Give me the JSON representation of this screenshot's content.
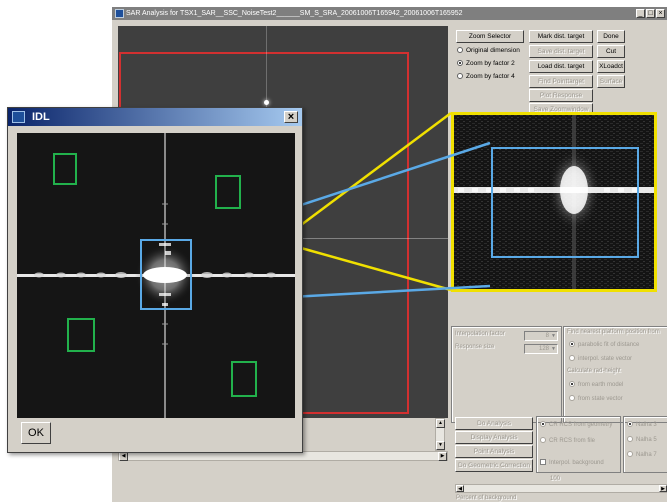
{
  "main_window": {
    "title": "SAR Analysis for TSX1_SAR__SSC_NoiseTest2______SM_S_SRA_20061006T165942_20061006T165952",
    "controls": {
      "minimize": "_",
      "maximize": "□",
      "close": "×"
    }
  },
  "zoom": {
    "selector_label": "Zoom Selector",
    "options": [
      {
        "label": "Original dimension",
        "selected": false
      },
      {
        "label": "Zoom by factor 2",
        "selected": true
      },
      {
        "label": "Zoom by factor 4",
        "selected": false
      }
    ]
  },
  "target_buttons": [
    {
      "label": "Mark dist. target",
      "enabled": true
    },
    {
      "label": "Save dist. target",
      "enabled": false
    },
    {
      "label": "Load dist. target",
      "enabled": true
    },
    {
      "label": "Find Pointtarget",
      "enabled": false
    },
    {
      "label": "Plot Response",
      "enabled": false
    },
    {
      "label": "Save Zoomwindow",
      "enabled": false
    }
  ],
  "action_buttons": [
    {
      "label": "Done",
      "enabled": true
    },
    {
      "label": "Cut",
      "enabled": true
    },
    {
      "label": "XLoadct",
      "enabled": true
    },
    {
      "label": "Surface",
      "enabled": false
    }
  ],
  "settings": {
    "interpolation_label": "Interpolation factor",
    "interpolation_value": "8",
    "response_label": "Response size",
    "response_value": "128"
  },
  "platform": {
    "heading": "Find nearest platform position from",
    "options": [
      "parabolic fit of distance",
      "interpol. state vector"
    ],
    "height_heading": "Calculate rad-height",
    "height_options": [
      "from earth model",
      "from state vector"
    ]
  },
  "analysis": {
    "buttons": [
      "Do Analysis",
      "Display Analysis",
      "Point Analysis",
      "Do Geometric Correction"
    ],
    "rcs_options": [
      "CR RCS from geometry",
      "CR RCS from file"
    ],
    "interpol_background": "Interpol. background",
    "natural": [
      "Nalha 3",
      "Nalha 5",
      "Nalha 7"
    ]
  },
  "slider": {
    "value": "100",
    "label": "Percent of background"
  },
  "idl_dialog": {
    "title": "IDL",
    "close": "×",
    "ok_label": "OK"
  },
  "colors": {
    "red_frame": "#d23030",
    "yellow_frame": "#f0e000",
    "blue_box": "#5aa9e6",
    "green_boxes": "#22b14c"
  }
}
